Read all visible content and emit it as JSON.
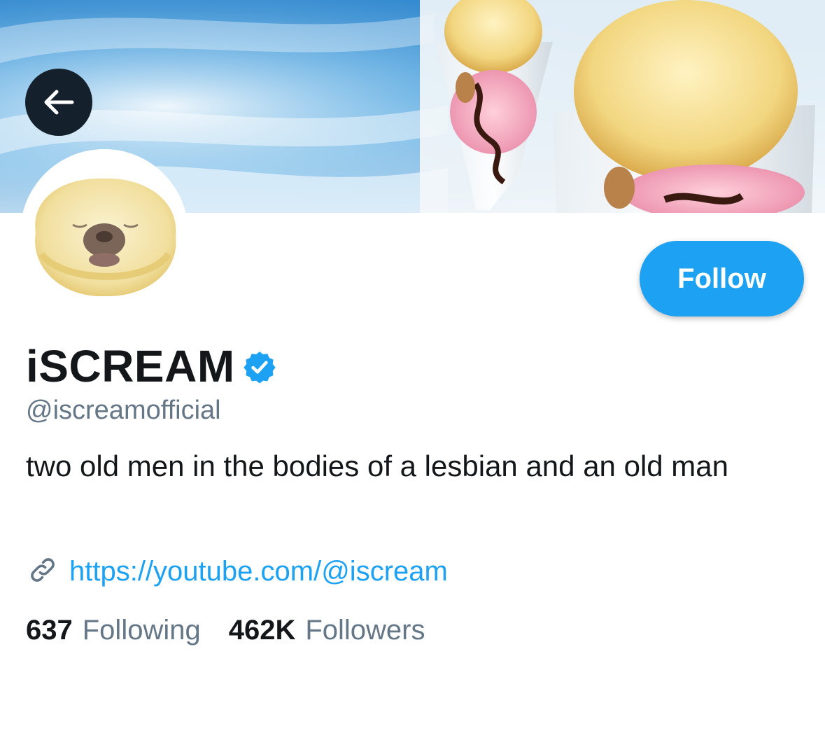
{
  "header": {
    "banner_image": "ice-cream-sundae-banner",
    "back_icon": "arrow-left-icon"
  },
  "profile": {
    "avatar": "ice-cream-scoop-pug-avatar",
    "display_name": "iSCREAM",
    "verified": true,
    "handle": "@iscreamofficial",
    "bio": "two old men in the bodies of a lesbian and an old man",
    "link_icon": "link-icon",
    "link": "https://youtube.com/@iscream",
    "following_count": "637",
    "following_label": "Following",
    "followers_count": "462K",
    "followers_label": "Followers"
  },
  "actions": {
    "follow_label": "Follow"
  },
  "colors": {
    "accent": "#1da1f2",
    "text_primary": "#14171a",
    "text_secondary": "#657786",
    "back_button_bg": "#14202c"
  }
}
